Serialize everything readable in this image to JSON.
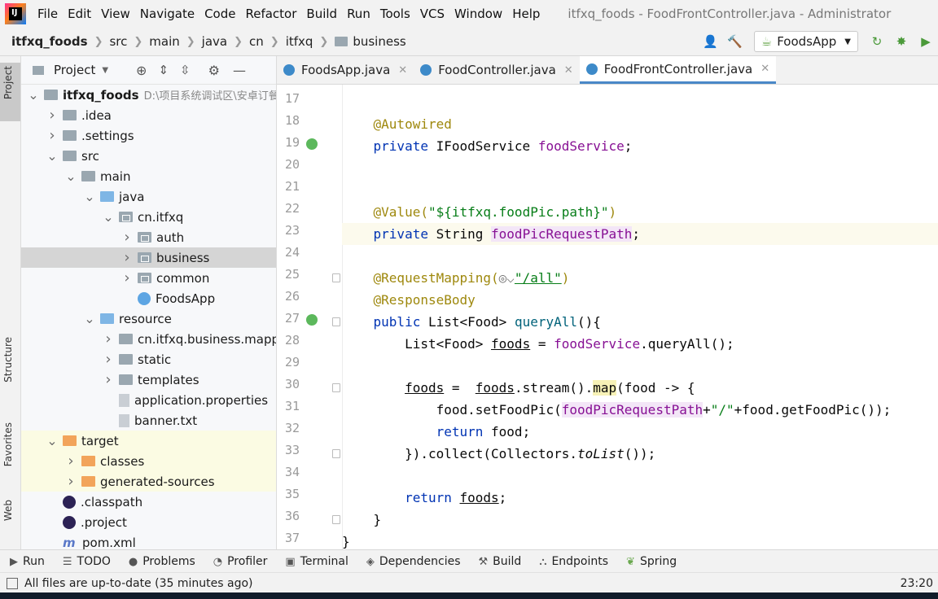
{
  "menu": [
    "File",
    "Edit",
    "View",
    "Navigate",
    "Code",
    "Refactor",
    "Build",
    "Run",
    "Tools",
    "VCS",
    "Window",
    "Help"
  ],
  "window_title": "itfxq_foods - FoodFrontController.java - Administrator",
  "breadcrumb": [
    "itfxq_foods",
    "src",
    "main",
    "java",
    "cn",
    "itfxq",
    "business"
  ],
  "run_config": "FoodsApp",
  "side_tabs": {
    "project": "Project",
    "structure": "Structure",
    "favorites": "Favorites",
    "web": "Web"
  },
  "project_panel": {
    "title": "Project"
  },
  "tree": [
    {
      "label": "itfxq_foods",
      "path": "D:\\项目系统调试区\\安卓订餐",
      "depth": 0,
      "arrow": "open",
      "icon": "folder-gray"
    },
    {
      "label": ".idea",
      "depth": 1,
      "arrow": "closed",
      "icon": "folder-gray"
    },
    {
      "label": ".settings",
      "depth": 1,
      "arrow": "closed",
      "icon": "folder-gray"
    },
    {
      "label": "src",
      "depth": 1,
      "arrow": "open",
      "icon": "folder-gray"
    },
    {
      "label": "main",
      "depth": 2,
      "arrow": "open",
      "icon": "folder-gray"
    },
    {
      "label": "java",
      "depth": 3,
      "arrow": "open",
      "icon": "folder-blue"
    },
    {
      "label": "cn.itfxq",
      "depth": 4,
      "arrow": "open",
      "icon": "package"
    },
    {
      "label": "auth",
      "depth": 5,
      "arrow": "closed",
      "icon": "package"
    },
    {
      "label": "business",
      "depth": 5,
      "arrow": "closed",
      "icon": "package",
      "selected": true
    },
    {
      "label": "common",
      "depth": 5,
      "arrow": "closed",
      "icon": "package"
    },
    {
      "label": "FoodsApp",
      "depth": 5,
      "arrow": "none",
      "icon": "class"
    },
    {
      "label": "resource",
      "depth": 3,
      "arrow": "open",
      "icon": "folder-blue"
    },
    {
      "label": "cn.itfxq.business.mapper",
      "depth": 4,
      "arrow": "closed",
      "icon": "folder-gray"
    },
    {
      "label": "static",
      "depth": 4,
      "arrow": "closed",
      "icon": "folder-gray"
    },
    {
      "label": "templates",
      "depth": 4,
      "arrow": "closed",
      "icon": "folder-gray"
    },
    {
      "label": "application.properties",
      "depth": 4,
      "arrow": "none",
      "icon": "file"
    },
    {
      "label": "banner.txt",
      "depth": 4,
      "arrow": "none",
      "icon": "file"
    },
    {
      "label": "target",
      "depth": 1,
      "arrow": "open",
      "icon": "folder-orange",
      "yellow": true
    },
    {
      "label": "classes",
      "depth": 2,
      "arrow": "closed",
      "icon": "folder-orange",
      "yellow": true
    },
    {
      "label": "generated-sources",
      "depth": 2,
      "arrow": "closed",
      "icon": "folder-orange",
      "yellow": true
    },
    {
      "label": ".classpath",
      "depth": 1,
      "arrow": "none",
      "icon": "eclipse"
    },
    {
      "label": ".project",
      "depth": 1,
      "arrow": "none",
      "icon": "eclipse"
    },
    {
      "label": "pom.xml",
      "depth": 1,
      "arrow": "none",
      "icon": "maven"
    }
  ],
  "tabs": [
    {
      "label": "FoodsApp.java",
      "active": false
    },
    {
      "label": "FoodController.java",
      "active": false
    },
    {
      "label": "FoodFrontController.java",
      "active": true
    }
  ],
  "line_numbers": [
    "17",
    "18",
    "19",
    "20",
    "21",
    "22",
    "23",
    "24",
    "25",
    "26",
    "27",
    "28",
    "29",
    "30",
    "31",
    "32",
    "33",
    "34",
    "35",
    "36",
    "37"
  ],
  "code": {
    "l18": "@Autowired",
    "l19_kw": "private ",
    "l19_type": "IFoodService ",
    "l19_field": "foodService",
    "l19_end": ";",
    "l22_ann": "@Value(",
    "l22_str": "\"${itfxq.foodPic.path}\"",
    "l22_end": ")",
    "l23_kw": "private ",
    "l23_type": "String ",
    "l23_field": "foodPicRequestPath",
    "l23_end": ";",
    "l25_ann": "@RequestMapping(",
    "l25_globe": "◎⌵",
    "l25_str": "\"/all\"",
    "l25_end": ")",
    "l26": "@ResponseBody",
    "l27_kw": "public ",
    "l27_type": "List<Food> ",
    "l27_fn": "queryAll",
    "l27_end": "(){",
    "l28_type": "List<Food> ",
    "l28_var": "foods",
    "l28_eq": " = ",
    "l28_field": "foodService",
    "l28_end": ".queryAll();",
    "l30_var": "foods",
    "l30_eq": " =  ",
    "l30_var2": "foods",
    "l30_stream": ".stream().",
    "l30_map": "map",
    "l30_end": "(food -> {",
    "l31_a": "food.setFoodPic(",
    "l31_field": "foodPicRequestPath",
    "l31_b": "+",
    "l31_str": "\"/\"",
    "l31_c": "+food.getFoodPic());",
    "l32_kw": "return ",
    "l32_end": "food;",
    "l33_a": "}).collect(Collectors.",
    "l33_it": "toList",
    "l33_end": "());",
    "l35_kw": "return ",
    "l35_var": "foods",
    "l35_end": ";",
    "l36": "}",
    "l37": "}"
  },
  "bottom_tools": [
    {
      "label": "Run",
      "icon": "run-icon"
    },
    {
      "label": "TODO",
      "icon": "todo-icon"
    },
    {
      "label": "Problems",
      "icon": "problems-icon"
    },
    {
      "label": "Profiler",
      "icon": "profiler-icon"
    },
    {
      "label": "Terminal",
      "icon": "terminal-icon"
    },
    {
      "label": "Dependencies",
      "icon": "dependencies-icon"
    },
    {
      "label": "Build",
      "icon": "build-icon"
    },
    {
      "label": "Endpoints",
      "icon": "endpoints-icon"
    },
    {
      "label": "Spring",
      "icon": "spring-icon"
    }
  ],
  "status_message": "All files are up-to-date (35 minutes ago)",
  "status_time": "23:20"
}
